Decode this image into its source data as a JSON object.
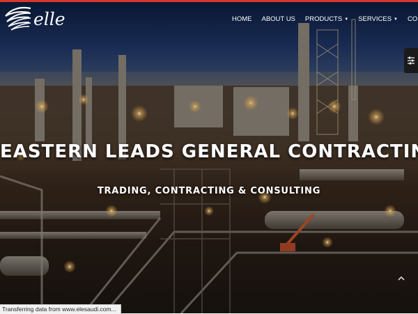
{
  "colors": {
    "accent_bar": "#d9362b",
    "nav_text": "#ffffff",
    "headline_text": "#ffffff",
    "side_toggle_bg": "#1a1a1a",
    "status_bg": "#f1f1f1"
  },
  "brand": {
    "logo_text": "elle",
    "logo_icon": "swoosh-logo-icon"
  },
  "nav": {
    "items": [
      {
        "label": "HOME",
        "has_dropdown": false
      },
      {
        "label": "ABOUT US",
        "has_dropdown": false
      },
      {
        "label": "PRODUCTS",
        "has_dropdown": true
      },
      {
        "label": "SERVICES",
        "has_dropdown": true
      },
      {
        "label": "CONTACT",
        "has_dropdown": false
      }
    ],
    "dropdown_icon": "caret-down-icon"
  },
  "side_panel": {
    "icon": "sliders-icon"
  },
  "hero": {
    "headline": "EASTERN LEADS GENERAL CONTRACTING EST.",
    "tagline": "TRADING, CONTRACTING & CONSULTING",
    "scroll_icon": "chevron-up-icon"
  },
  "status": {
    "text": "Transferring data from www.elesaudi.com..."
  }
}
